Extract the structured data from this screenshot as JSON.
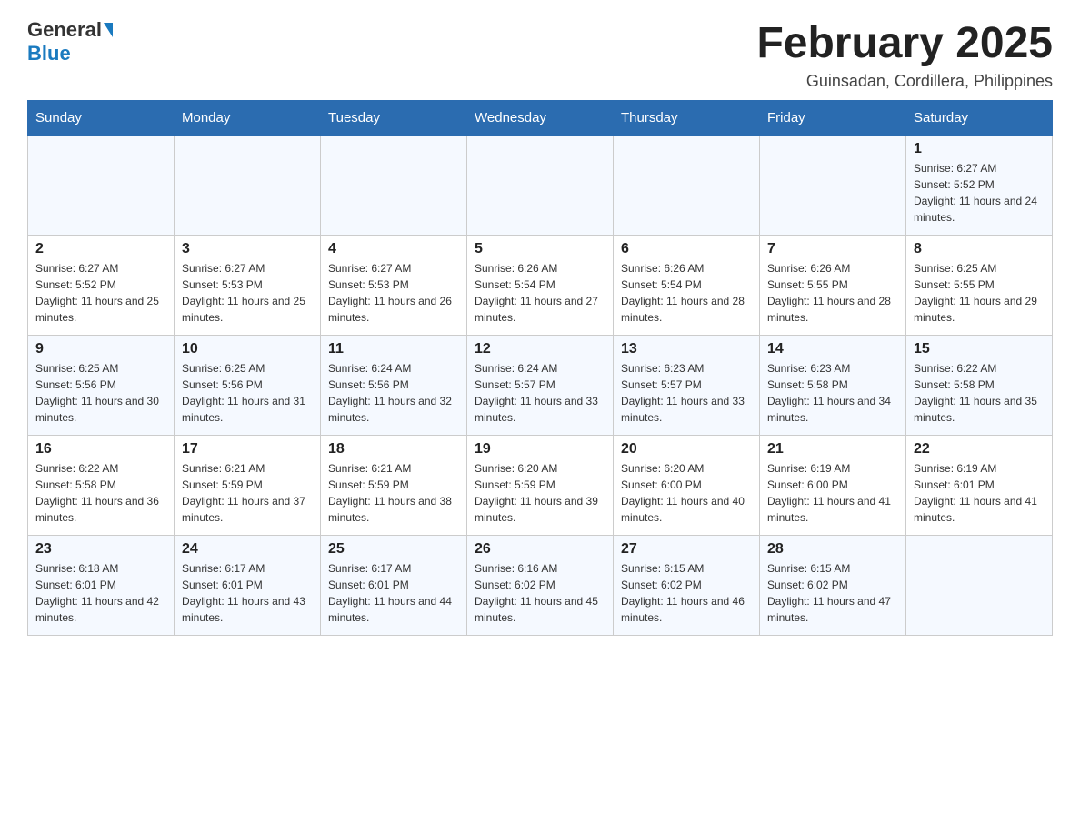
{
  "header": {
    "logo_general": "General",
    "logo_blue": "Blue",
    "month_title": "February 2025",
    "location": "Guinsadan, Cordillera, Philippines"
  },
  "days_of_week": [
    "Sunday",
    "Monday",
    "Tuesday",
    "Wednesday",
    "Thursday",
    "Friday",
    "Saturday"
  ],
  "weeks": [
    [
      {
        "day": "",
        "sunrise": "",
        "sunset": "",
        "daylight": ""
      },
      {
        "day": "",
        "sunrise": "",
        "sunset": "",
        "daylight": ""
      },
      {
        "day": "",
        "sunrise": "",
        "sunset": "",
        "daylight": ""
      },
      {
        "day": "",
        "sunrise": "",
        "sunset": "",
        "daylight": ""
      },
      {
        "day": "",
        "sunrise": "",
        "sunset": "",
        "daylight": ""
      },
      {
        "day": "",
        "sunrise": "",
        "sunset": "",
        "daylight": ""
      },
      {
        "day": "1",
        "sunrise": "Sunrise: 6:27 AM",
        "sunset": "Sunset: 5:52 PM",
        "daylight": "Daylight: 11 hours and 24 minutes."
      }
    ],
    [
      {
        "day": "2",
        "sunrise": "Sunrise: 6:27 AM",
        "sunset": "Sunset: 5:52 PM",
        "daylight": "Daylight: 11 hours and 25 minutes."
      },
      {
        "day": "3",
        "sunrise": "Sunrise: 6:27 AM",
        "sunset": "Sunset: 5:53 PM",
        "daylight": "Daylight: 11 hours and 25 minutes."
      },
      {
        "day": "4",
        "sunrise": "Sunrise: 6:27 AM",
        "sunset": "Sunset: 5:53 PM",
        "daylight": "Daylight: 11 hours and 26 minutes."
      },
      {
        "day": "5",
        "sunrise": "Sunrise: 6:26 AM",
        "sunset": "Sunset: 5:54 PM",
        "daylight": "Daylight: 11 hours and 27 minutes."
      },
      {
        "day": "6",
        "sunrise": "Sunrise: 6:26 AM",
        "sunset": "Sunset: 5:54 PM",
        "daylight": "Daylight: 11 hours and 28 minutes."
      },
      {
        "day": "7",
        "sunrise": "Sunrise: 6:26 AM",
        "sunset": "Sunset: 5:55 PM",
        "daylight": "Daylight: 11 hours and 28 minutes."
      },
      {
        "day": "8",
        "sunrise": "Sunrise: 6:25 AM",
        "sunset": "Sunset: 5:55 PM",
        "daylight": "Daylight: 11 hours and 29 minutes."
      }
    ],
    [
      {
        "day": "9",
        "sunrise": "Sunrise: 6:25 AM",
        "sunset": "Sunset: 5:56 PM",
        "daylight": "Daylight: 11 hours and 30 minutes."
      },
      {
        "day": "10",
        "sunrise": "Sunrise: 6:25 AM",
        "sunset": "Sunset: 5:56 PM",
        "daylight": "Daylight: 11 hours and 31 minutes."
      },
      {
        "day": "11",
        "sunrise": "Sunrise: 6:24 AM",
        "sunset": "Sunset: 5:56 PM",
        "daylight": "Daylight: 11 hours and 32 minutes."
      },
      {
        "day": "12",
        "sunrise": "Sunrise: 6:24 AM",
        "sunset": "Sunset: 5:57 PM",
        "daylight": "Daylight: 11 hours and 33 minutes."
      },
      {
        "day": "13",
        "sunrise": "Sunrise: 6:23 AM",
        "sunset": "Sunset: 5:57 PM",
        "daylight": "Daylight: 11 hours and 33 minutes."
      },
      {
        "day": "14",
        "sunrise": "Sunrise: 6:23 AM",
        "sunset": "Sunset: 5:58 PM",
        "daylight": "Daylight: 11 hours and 34 minutes."
      },
      {
        "day": "15",
        "sunrise": "Sunrise: 6:22 AM",
        "sunset": "Sunset: 5:58 PM",
        "daylight": "Daylight: 11 hours and 35 minutes."
      }
    ],
    [
      {
        "day": "16",
        "sunrise": "Sunrise: 6:22 AM",
        "sunset": "Sunset: 5:58 PM",
        "daylight": "Daylight: 11 hours and 36 minutes."
      },
      {
        "day": "17",
        "sunrise": "Sunrise: 6:21 AM",
        "sunset": "Sunset: 5:59 PM",
        "daylight": "Daylight: 11 hours and 37 minutes."
      },
      {
        "day": "18",
        "sunrise": "Sunrise: 6:21 AM",
        "sunset": "Sunset: 5:59 PM",
        "daylight": "Daylight: 11 hours and 38 minutes."
      },
      {
        "day": "19",
        "sunrise": "Sunrise: 6:20 AM",
        "sunset": "Sunset: 5:59 PM",
        "daylight": "Daylight: 11 hours and 39 minutes."
      },
      {
        "day": "20",
        "sunrise": "Sunrise: 6:20 AM",
        "sunset": "Sunset: 6:00 PM",
        "daylight": "Daylight: 11 hours and 40 minutes."
      },
      {
        "day": "21",
        "sunrise": "Sunrise: 6:19 AM",
        "sunset": "Sunset: 6:00 PM",
        "daylight": "Daylight: 11 hours and 41 minutes."
      },
      {
        "day": "22",
        "sunrise": "Sunrise: 6:19 AM",
        "sunset": "Sunset: 6:01 PM",
        "daylight": "Daylight: 11 hours and 41 minutes."
      }
    ],
    [
      {
        "day": "23",
        "sunrise": "Sunrise: 6:18 AM",
        "sunset": "Sunset: 6:01 PM",
        "daylight": "Daylight: 11 hours and 42 minutes."
      },
      {
        "day": "24",
        "sunrise": "Sunrise: 6:17 AM",
        "sunset": "Sunset: 6:01 PM",
        "daylight": "Daylight: 11 hours and 43 minutes."
      },
      {
        "day": "25",
        "sunrise": "Sunrise: 6:17 AM",
        "sunset": "Sunset: 6:01 PM",
        "daylight": "Daylight: 11 hours and 44 minutes."
      },
      {
        "day": "26",
        "sunrise": "Sunrise: 6:16 AM",
        "sunset": "Sunset: 6:02 PM",
        "daylight": "Daylight: 11 hours and 45 minutes."
      },
      {
        "day": "27",
        "sunrise": "Sunrise: 6:15 AM",
        "sunset": "Sunset: 6:02 PM",
        "daylight": "Daylight: 11 hours and 46 minutes."
      },
      {
        "day": "28",
        "sunrise": "Sunrise: 6:15 AM",
        "sunset": "Sunset: 6:02 PM",
        "daylight": "Daylight: 11 hours and 47 minutes."
      },
      {
        "day": "",
        "sunrise": "",
        "sunset": "",
        "daylight": ""
      }
    ]
  ]
}
